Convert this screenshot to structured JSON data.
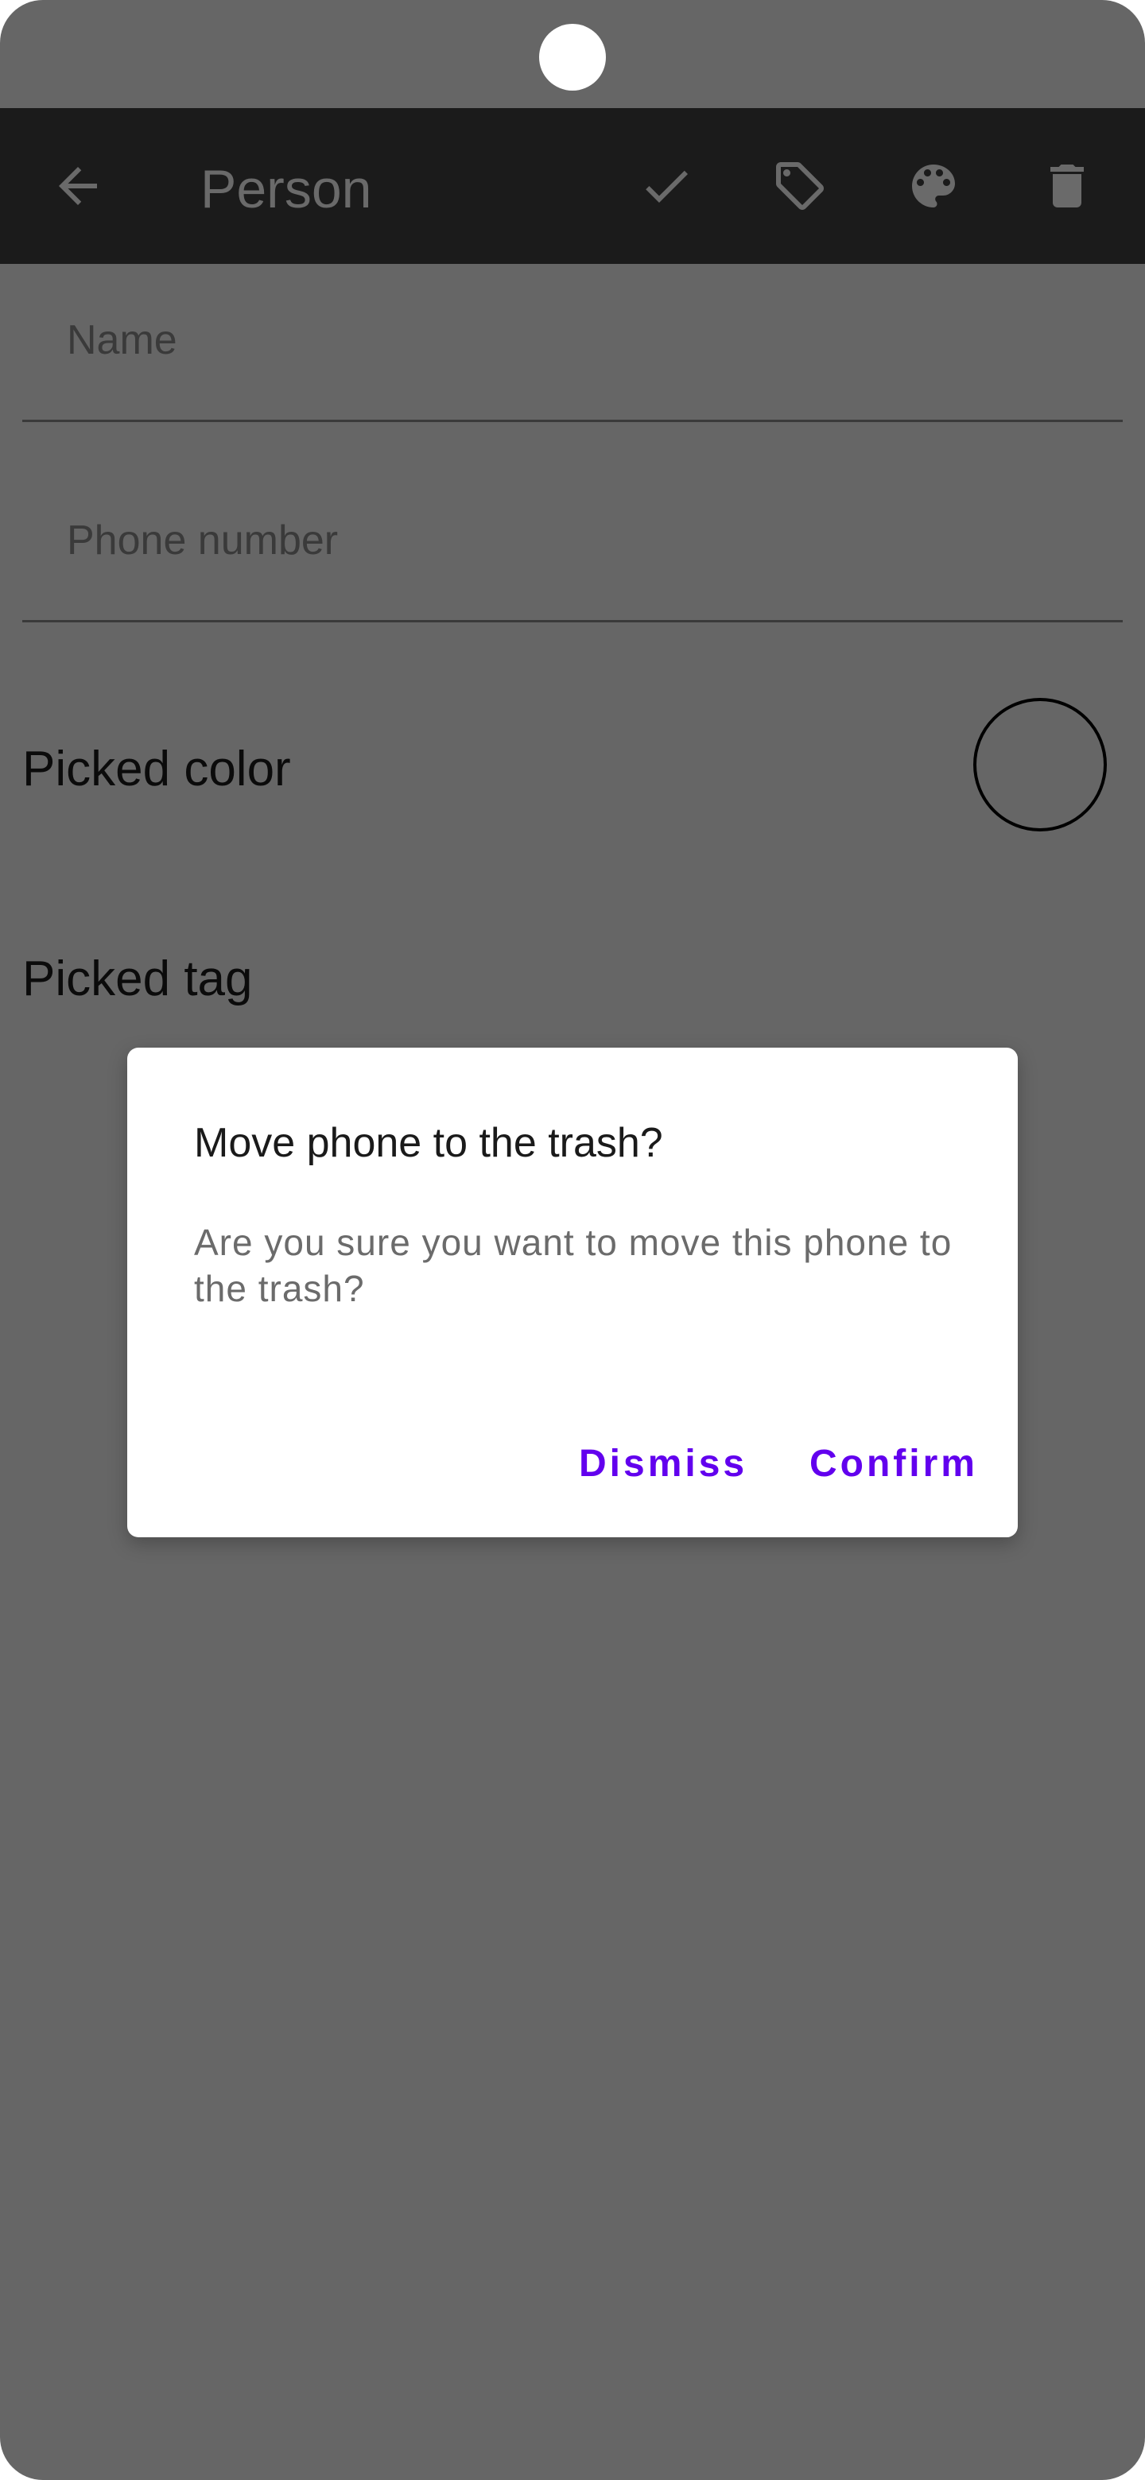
{
  "toolbar": {
    "title": "Person",
    "icons": {
      "back": "arrow-back-icon",
      "save": "check-icon",
      "tag": "tag-icon",
      "color": "palette-icon",
      "delete": "trash-icon"
    }
  },
  "form": {
    "name_placeholder": "Name",
    "phone_placeholder": "Phone number",
    "picked_color_label": "Picked color",
    "picked_tag_label": "Picked tag"
  },
  "dialog": {
    "title": "Move phone to the trash?",
    "message": "Are you sure you want to move this phone to the trash?",
    "dismiss_label": "Dismiss",
    "confirm_label": "Confirm"
  },
  "colors": {
    "scrim": "#666666",
    "appbar": "#1b1b1b",
    "accent": "#6200ee",
    "dialog_bg": "#ffffff"
  }
}
